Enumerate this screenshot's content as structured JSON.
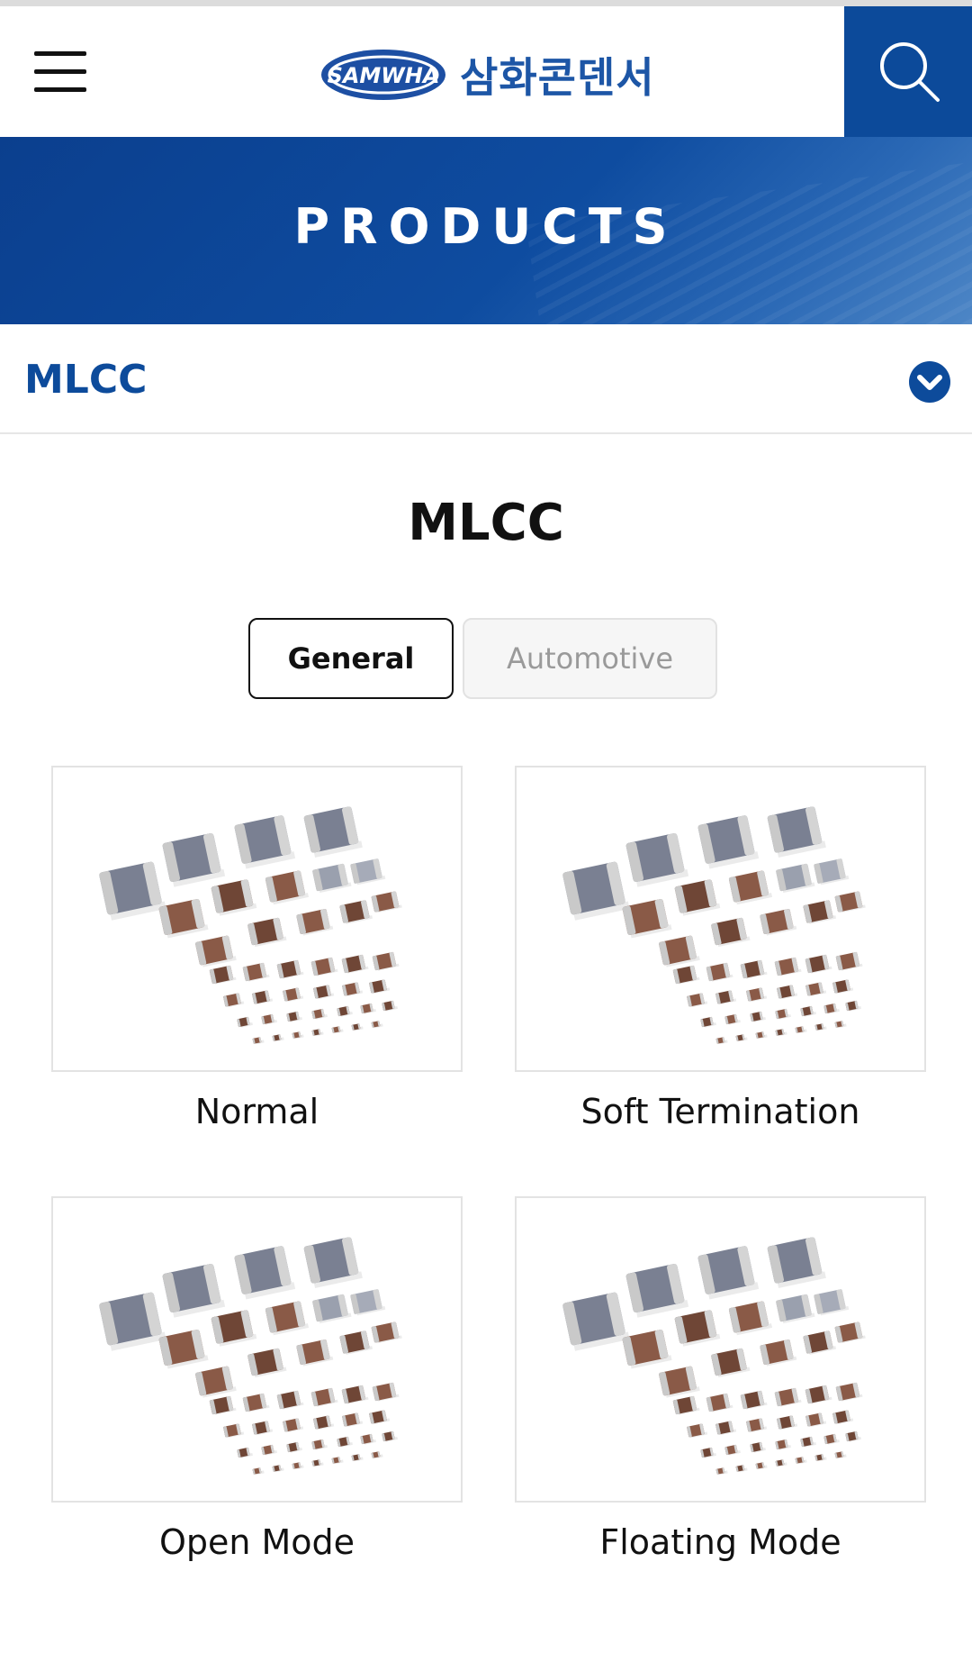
{
  "header": {
    "logo_en": "SAMWHA",
    "logo_kr": "삼화콘덴서"
  },
  "banner": {
    "title": "PRODUCTS"
  },
  "category": {
    "selected": "MLCC"
  },
  "main": {
    "title": "MLCC",
    "tabs": [
      {
        "label": "General",
        "active": true
      },
      {
        "label": "Automotive",
        "active": false
      }
    ],
    "products": [
      {
        "name": "Normal"
      },
      {
        "name": "Soft Termination"
      },
      {
        "name": "Open Mode"
      },
      {
        "name": "Floating Mode"
      }
    ]
  },
  "colors": {
    "brand_blue": "#0c4a9a",
    "text_dark": "#111111",
    "inactive_tab_text": "#9a9a9a"
  },
  "icons": [
    "hamburger-menu-icon",
    "search-icon",
    "chevron-down-icon"
  ]
}
